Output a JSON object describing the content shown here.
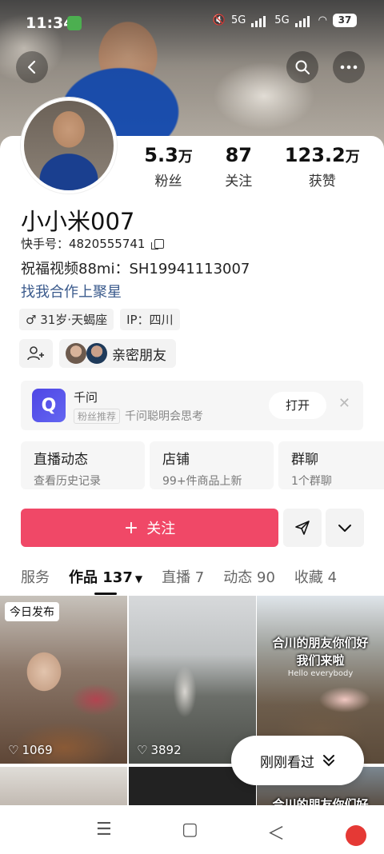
{
  "status_bar": {
    "time": "11:34",
    "network_1": "5G",
    "network_2": "5G",
    "battery": "37"
  },
  "header": {
    "back_icon": "back-arrow-icon",
    "search_icon": "search-icon",
    "more_icon": "more-icon"
  },
  "profile": {
    "stats": [
      {
        "value": "5.3",
        "unit": "万",
        "label": "粉丝"
      },
      {
        "value": "87",
        "unit": "",
        "label": "关注"
      },
      {
        "value": "123.2",
        "unit": "万",
        "label": "获赞"
      }
    ],
    "name": "小小米007",
    "kuaishou_id_label": "快手号：",
    "kuaishou_id": "4820555741",
    "bio": "祝福视频88mi：SH19941113007",
    "link": "找我合作上聚星",
    "tags": [
      "♂ 31岁·天蝎座",
      "IP：四川"
    ],
    "close_friends_label": "亲密朋友"
  },
  "recommendation": {
    "logo_text": "Q",
    "title": "千问",
    "badge": "粉丝推荐",
    "subtitle": "千问聪明会思考",
    "open_label": "打开",
    "close_label": "✕"
  },
  "features": [
    {
      "title": "直播动态",
      "subtitle": "查看历史记录"
    },
    {
      "title": "店铺",
      "subtitle": "99+件商品上新"
    },
    {
      "title": "群聊",
      "subtitle": "1个群聊"
    }
  ],
  "actions": {
    "follow_label": "关注",
    "follow_prefix": "+"
  },
  "tabs": [
    {
      "label": "服务"
    },
    {
      "label": "作品 137"
    },
    {
      "label": "直播 7"
    },
    {
      "label": "动态 90"
    },
    {
      "label": "收藏 4"
    }
  ],
  "videos": [
    {
      "badge": "今日发布",
      "likes": "1069"
    },
    {
      "likes": "3892"
    },
    {
      "overlay_line1": "合川的朋友你们好",
      "overlay_line2": "我们来啦",
      "overlay_small": "Hello everybody"
    },
    {},
    {},
    {
      "overlay_line1": "合川的朋友你们好"
    }
  ],
  "recently_viewed": {
    "label": "刚刚看过"
  },
  "nav": {
    "menu": "☰",
    "home": "▢",
    "back": "＜"
  }
}
